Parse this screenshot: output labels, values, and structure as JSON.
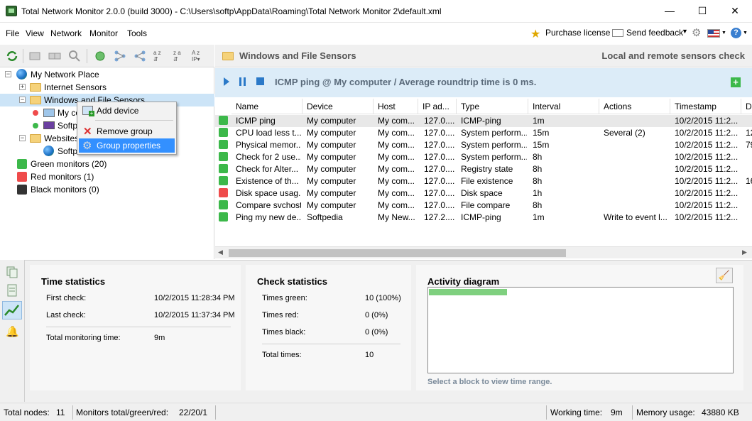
{
  "window": {
    "title": "Total Network Monitor 2.0.0 (build 3000) - C:\\Users\\softp\\AppData\\Roaming\\Total Network Monitor 2\\default.xml",
    "minimize": "—",
    "maximize": "☐",
    "close": "✕"
  },
  "menu": {
    "items": [
      "File",
      "View",
      "Network",
      "Monitor",
      "Tools"
    ],
    "purchase_label": "Purchase license",
    "feedback_label": "Send feedback"
  },
  "tree": {
    "root": "My Network Place",
    "internet_sensors": "Internet Sensors",
    "windows_file_sensors": "Windows and File Sensors",
    "my_computer": "My co",
    "softpedia": "Softpe",
    "websites": "Websites",
    "softpedia2": "Softpe",
    "green_monitors": "Green monitors (20)",
    "red_monitors": "Red monitors (1)",
    "black_monitors": "Black monitors (0)"
  },
  "context_menu": {
    "add_device": "Add device",
    "remove_group": "Remove group",
    "group_properties": "Group properties"
  },
  "header": {
    "title": "Windows and File Sensors",
    "right_title": "Local and remote sensors check"
  },
  "sensor": {
    "text": "ICMP ping @ My computer /  Average roundtrip time is 0 ms."
  },
  "grid": {
    "columns": [
      "Name",
      "Device",
      "Host",
      "IP ad...",
      "Type",
      "Interval",
      "Actions",
      "Timestamp",
      "D"
    ],
    "rows": [
      {
        "status": "green",
        "name": "ICMP ping",
        "device": "My computer",
        "host": "My com...",
        "ip": "127.0....",
        "type": "ICMP-ping",
        "interval": "1m",
        "actions": "",
        "timestamp": "10/2/2015 11:2...",
        "d": ""
      },
      {
        "status": "green",
        "name": "CPU load less t...",
        "device": "My computer",
        "host": "My com...",
        "ip": "127.0....",
        "type": "System perform...",
        "interval": "15m",
        "actions": "Several (2)",
        "timestamp": "10/2/2015 11:2...",
        "d": "12"
      },
      {
        "status": "green",
        "name": "Physical memor...",
        "device": "My computer",
        "host": "My com...",
        "ip": "127.0....",
        "type": "System perform...",
        "interval": "15m",
        "actions": "",
        "timestamp": "10/2/2015 11:2...",
        "d": "79"
      },
      {
        "status": "green",
        "name": "Check for 2 use...",
        "device": "My computer",
        "host": "My com...",
        "ip": "127.0....",
        "type": "System perform...",
        "interval": "8h",
        "actions": "",
        "timestamp": "10/2/2015 11:2...",
        "d": ""
      },
      {
        "status": "green",
        "name": "Check for Alter...",
        "device": "My computer",
        "host": "My com...",
        "ip": "127.0....",
        "type": "Registry state",
        "interval": "8h",
        "actions": "",
        "timestamp": "10/2/2015 11:2...",
        "d": ""
      },
      {
        "status": "green",
        "name": "Existence of th...",
        "device": "My computer",
        "host": "My com...",
        "ip": "127.0....",
        "type": "File existence",
        "interval": "8h",
        "actions": "",
        "timestamp": "10/2/2015 11:2...",
        "d": "16"
      },
      {
        "status": "red",
        "name": "Disk space usag...",
        "device": "My computer",
        "host": "My com...",
        "ip": "127.0....",
        "type": "Disk space",
        "interval": "1h",
        "actions": "",
        "timestamp": "10/2/2015 11:2...",
        "d": ""
      },
      {
        "status": "green",
        "name": "Compare svchost",
        "device": "My computer",
        "host": "My com...",
        "ip": "127.0....",
        "type": "File compare",
        "interval": "8h",
        "actions": "",
        "timestamp": "10/2/2015 11:2...",
        "d": ""
      },
      {
        "status": "green",
        "name": "Ping my new de...",
        "device": "Softpedia",
        "host": "My New...",
        "ip": "127.2....",
        "type": "ICMP-ping",
        "interval": "1m",
        "actions": "Write to event l...",
        "timestamp": "10/2/2015 11:2...",
        "d": ""
      }
    ]
  },
  "time_stats": {
    "title": "Time statistics",
    "first_check_label": "First check:",
    "first_check_value": "10/2/2015 11:28:34 PM",
    "last_check_label": "Last check:",
    "last_check_value": "10/2/2015 11:37:34 PM",
    "total_label": "Total monitoring time:",
    "total_value": "9m"
  },
  "check_stats": {
    "title": "Check statistics",
    "green_label": "Times green:",
    "green_value": "10 (100%)",
    "red_label": "Times red:",
    "red_value": "0 (0%)",
    "black_label": "Times black:",
    "black_value": "0 (0%)",
    "total_label": "Total times:",
    "total_value": "10"
  },
  "activity": {
    "title": "Activity diagram",
    "hint": "Select a block to view time range.",
    "bar_fill_fraction": 0.25
  },
  "status": {
    "total_nodes_label": "Total nodes:",
    "total_nodes_value": "11",
    "monitors_label": "Monitors total/green/red:",
    "monitors_value": "22/20/1",
    "working_label": "Working time:",
    "working_value": "9m",
    "memory_label": "Memory usage:",
    "memory_value": "43880 KB"
  },
  "colors": {
    "green": "#3cb84a",
    "red": "#ef4b4b",
    "black": "#333333",
    "selection": "#cce4f7",
    "highlight": "#3390ff",
    "activity_bar": "#7fd07f"
  }
}
